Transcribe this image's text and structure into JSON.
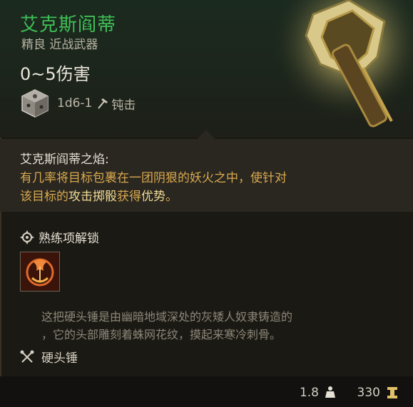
{
  "item": {
    "name": "艾克斯阎蒂",
    "type": "精良 近战武器",
    "damage": "0~5伤害",
    "dice_formula": "1d6-1",
    "damage_type": "钝击",
    "damage_type_icon": "hammer-icon"
  },
  "passive": {
    "title": "艾克斯阎蒂之焰:",
    "line1": "有几率将目标包裹在一团阴狠的妖火之中，使针对",
    "line2_pre": "该目标的",
    "line2_hl1": "攻击掷骰",
    "line2_mid": "获得",
    "line2_hl2": "优势",
    "line2_post": "。"
  },
  "proficiency": {
    "label": "熟练项解锁",
    "icon": "flame-gear-icon"
  },
  "lore": {
    "line1": "这把硬头锤是由幽暗地域深处的灰矮人奴隶铸造的",
    "line2": "，它的头部雕刻着蛛网花纹，摸起来寒冷刺骨。"
  },
  "category": {
    "label": "硬头锤",
    "icon": "crossed-maces-icon"
  },
  "footer": {
    "weight": "1.8",
    "price": "330"
  },
  "colors": {
    "name_green": "#3fbf56",
    "passive_gold": "#d9a94e",
    "highlight": "#f1dc95"
  }
}
